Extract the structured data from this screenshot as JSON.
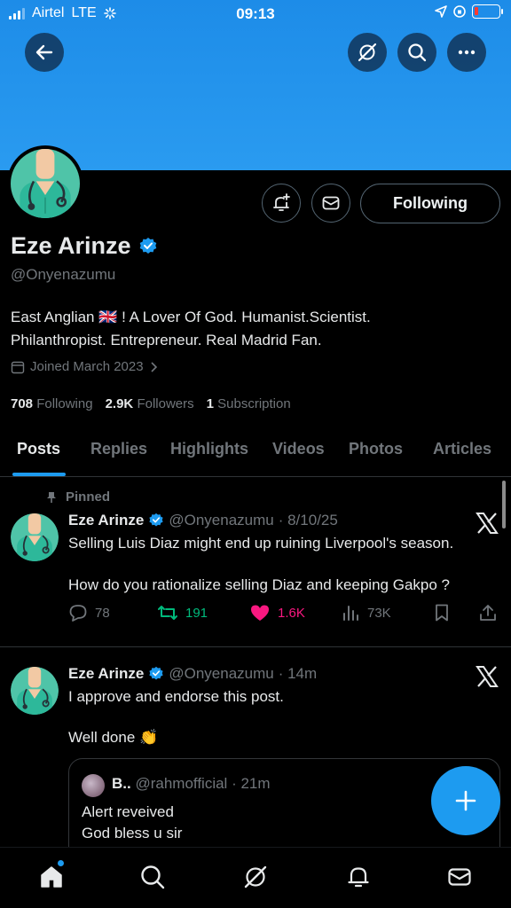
{
  "status_bar": {
    "carrier": "Airtel",
    "network": "LTE",
    "time": "09:13"
  },
  "colors": {
    "accent": "#1d9bf0",
    "banner": "#2a9bf0",
    "like": "#f91880",
    "repost": "#00ba7c",
    "muted": "#71767b"
  },
  "profile": {
    "name": "Eze Arinze",
    "handle": "@Onyenazumu",
    "bio_line1": "East Anglian 🇬🇧 ! A Lover Of God. Humanist.Scientist.",
    "bio_line2": "Philanthropist. Entrepreneur. Real Madrid Fan.",
    "joined": "Joined March 2023",
    "following_count": "708",
    "following_label": "Following",
    "followers_count": "2.9K",
    "followers_label": "Followers",
    "subscriptions_count": "1",
    "subscriptions_label": "Subscription",
    "follow_button": "Following"
  },
  "tabs": [
    {
      "label": "Posts",
      "active": true
    },
    {
      "label": "Replies"
    },
    {
      "label": "Highlights"
    },
    {
      "label": "Videos"
    },
    {
      "label": "Photos"
    },
    {
      "label": "Articles"
    }
  ],
  "posts": [
    {
      "pinned_label": "Pinned",
      "name": "Eze Arinze",
      "handle": "@Onyenazumu",
      "date": "· 8/10/25",
      "line1": "Selling Luis Diaz might end up ruining Liverpool's season.",
      "line2": "How do you rationalize selling Diaz and keeping Gakpo ?",
      "replies": "78",
      "reposts": "191",
      "likes": "1.6K",
      "views": "73K"
    },
    {
      "name": "Eze Arinze",
      "handle": "@Onyenazumu",
      "date": "· 14m",
      "line1": "I approve and endorse this post.",
      "line2": "Well done 👏",
      "quote": {
        "name": "B..",
        "handle": "@rahmofficial",
        "date": "· 21m",
        "line1": "Alert reveived",
        "line2": "God bless u sir"
      }
    }
  ]
}
